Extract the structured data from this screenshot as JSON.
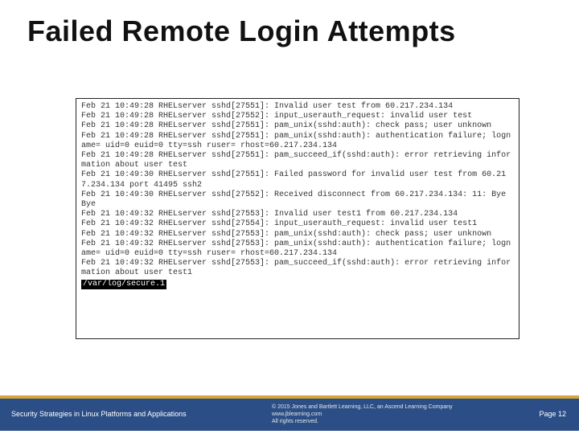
{
  "title": "Failed Remote Login Attempts",
  "log_lines": [
    "Feb 21 10:49:28 RHELserver sshd[27551]: Invalid user test from 60.217.234.134",
    "Feb 21 10:49:28 RHELserver sshd[27552]: input_userauth_request: invalid user test",
    "Feb 21 10:49:28 RHELserver sshd[27551]: pam_unix(sshd:auth): check pass; user unknown",
    "Feb 21 10:49:28 RHELserver sshd[27551]: pam_unix(sshd:auth): authentication failure; logname= uid=0 euid=0 tty=ssh ruser= rhost=60.217.234.134",
    "Feb 21 10:49:28 RHELserver sshd[27551]: pam_succeed_if(sshd:auth): error retrieving information about user test",
    "Feb 21 10:49:30 RHELserver sshd[27551]: Failed password for invalid user test from 60.217.234.134 port 41495 ssh2",
    "Feb 21 10:49:30 RHELserver sshd[27552]: Received disconnect from 60.217.234.134: 11: Bye Bye",
    "Feb 21 10:49:32 RHELserver sshd[27553]: Invalid user test1 from 60.217.234.134",
    "Feb 21 10:49:32 RHELserver sshd[27554]: input_userauth_request: invalid user test1",
    "Feb 21 10:49:32 RHELserver sshd[27553]: pam_unix(sshd:auth): check pass; user unknown",
    "Feb 21 10:49:32 RHELserver sshd[27553]: pam_unix(sshd:auth): authentication failure; logname= uid=0 euid=0 tty=ssh ruser= rhost=60.217.234.134",
    "Feb 21 10:49:32 RHELserver sshd[27553]: pam_succeed_if(sshd:auth): error retrieving information about user test1"
  ],
  "log_path": "/var/log/secure.1",
  "footer": {
    "left": "Security Strategies in Linux Platforms and Applications",
    "copyright": "© 2015 Jones and Bartlett Learning, LLC, an Ascend Learning Company",
    "url": "www.jblearning.com",
    "rights": "All rights reserved.",
    "page": "Page 12"
  }
}
